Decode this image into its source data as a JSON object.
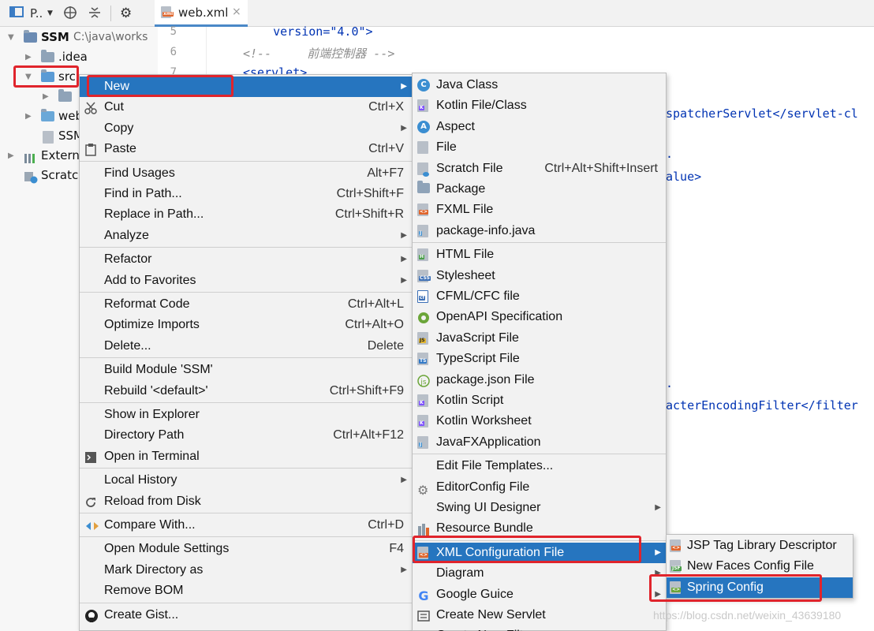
{
  "toolbar": {
    "project_label": "P..",
    "tab_label": "web.xml",
    "tab_close": "×"
  },
  "project_tree": {
    "root_name": "SSM",
    "root_path": "C:\\java\\works",
    "items": [
      ".idea",
      "src",
      "",
      "web",
      "SSM",
      "Externa",
      "Scratch"
    ]
  },
  "editor": {
    "line_numbers": [
      "5",
      "6",
      "7"
    ],
    "lines": [
      "    version=\"4.0\">",
      "<!--     前端控制器 -->",
      "<servlet>",
      "spatcherServlet</servlet-cl",
      ".",
      "alue>",
      ".",
      "acterEncodingFilter</filter"
    ]
  },
  "context_menu": [
    {
      "label": "New",
      "shortcut": "",
      "submenu": true,
      "selected": true,
      "icon": ""
    },
    {
      "label": "Cut",
      "shortcut": "Ctrl+X",
      "submenu": false,
      "icon": "scissors-icon"
    },
    {
      "label": "Copy",
      "shortcut": "",
      "submenu": true,
      "icon": ""
    },
    {
      "label": "Paste",
      "shortcut": "Ctrl+V",
      "submenu": false,
      "icon": "clipboard-icon"
    },
    {
      "label": "Find Usages",
      "shortcut": "Alt+F7",
      "submenu": false,
      "icon": ""
    },
    {
      "label": "Find in Path...",
      "shortcut": "Ctrl+Shift+F",
      "submenu": false,
      "icon": ""
    },
    {
      "label": "Replace in Path...",
      "shortcut": "Ctrl+Shift+R",
      "submenu": false,
      "icon": ""
    },
    {
      "label": "Analyze",
      "shortcut": "",
      "submenu": true,
      "icon": ""
    },
    {
      "label": "Refactor",
      "shortcut": "",
      "submenu": true,
      "icon": ""
    },
    {
      "label": "Add to Favorites",
      "shortcut": "",
      "submenu": true,
      "icon": ""
    },
    {
      "label": "Reformat Code",
      "shortcut": "Ctrl+Alt+L",
      "submenu": false,
      "icon": ""
    },
    {
      "label": "Optimize Imports",
      "shortcut": "Ctrl+Alt+O",
      "submenu": false,
      "icon": ""
    },
    {
      "label": "Delete...",
      "shortcut": "Delete",
      "submenu": false,
      "icon": ""
    },
    {
      "label": "Build Module 'SSM'",
      "shortcut": "",
      "submenu": false,
      "icon": ""
    },
    {
      "label": "Rebuild '<default>'",
      "shortcut": "Ctrl+Shift+F9",
      "submenu": false,
      "icon": ""
    },
    {
      "label": "Show in Explorer",
      "shortcut": "",
      "submenu": false,
      "icon": ""
    },
    {
      "label": "Directory Path",
      "shortcut": "Ctrl+Alt+F12",
      "submenu": false,
      "icon": ""
    },
    {
      "label": "Open in Terminal",
      "shortcut": "",
      "submenu": false,
      "icon": "terminal-icon"
    },
    {
      "label": "Local History",
      "shortcut": "",
      "submenu": true,
      "icon": ""
    },
    {
      "label": "Reload from Disk",
      "shortcut": "",
      "submenu": false,
      "icon": "reload-icon"
    },
    {
      "label": "Compare With...",
      "shortcut": "Ctrl+D",
      "submenu": false,
      "icon": "compare-icon"
    },
    {
      "label": "Open Module Settings",
      "shortcut": "F4",
      "submenu": false,
      "icon": ""
    },
    {
      "label": "Mark Directory as",
      "shortcut": "",
      "submenu": true,
      "icon": ""
    },
    {
      "label": "Remove BOM",
      "shortcut": "",
      "submenu": false,
      "icon": ""
    },
    {
      "label": "Create Gist...",
      "shortcut": "",
      "submenu": false,
      "icon": "github-icon"
    }
  ],
  "new_submenu": [
    {
      "label": "Java Class",
      "shortcut": "",
      "submenu": false,
      "icon": "java-class-icon"
    },
    {
      "label": "Kotlin File/Class",
      "shortcut": "",
      "submenu": false,
      "icon": "kotlin-icon"
    },
    {
      "label": "Aspect",
      "shortcut": "",
      "submenu": false,
      "icon": "aspect-icon"
    },
    {
      "label": "File",
      "shortcut": "",
      "submenu": false,
      "icon": "file-icon"
    },
    {
      "label": "Scratch File",
      "shortcut": "Ctrl+Alt+Shift+Insert",
      "submenu": false,
      "icon": "scratch-file-icon"
    },
    {
      "label": "Package",
      "shortcut": "",
      "submenu": false,
      "icon": "package-icon"
    },
    {
      "label": "FXML File",
      "shortcut": "",
      "submenu": false,
      "icon": "fxml-file-icon"
    },
    {
      "label": "package-info.java",
      "shortcut": "",
      "submenu": false,
      "icon": "package-info-icon"
    },
    {
      "label": "HTML File",
      "shortcut": "",
      "submenu": false,
      "icon": "html-file-icon"
    },
    {
      "label": "Stylesheet",
      "shortcut": "",
      "submenu": false,
      "icon": "css-file-icon"
    },
    {
      "label": "CFML/CFC file",
      "shortcut": "",
      "submenu": false,
      "icon": "cfml-file-icon"
    },
    {
      "label": "OpenAPI Specification",
      "shortcut": "",
      "submenu": false,
      "icon": "openapi-icon"
    },
    {
      "label": "JavaScript File",
      "shortcut": "",
      "submenu": false,
      "icon": "javascript-file-icon"
    },
    {
      "label": "TypeScript File",
      "shortcut": "",
      "submenu": false,
      "icon": "typescript-file-icon"
    },
    {
      "label": "package.json File",
      "shortcut": "",
      "submenu": false,
      "icon": "package-json-icon"
    },
    {
      "label": "Kotlin Script",
      "shortcut": "",
      "submenu": false,
      "icon": "kotlin-script-icon"
    },
    {
      "label": "Kotlin Worksheet",
      "shortcut": "",
      "submenu": false,
      "icon": "kotlin-worksheet-icon"
    },
    {
      "label": "JavaFXApplication",
      "shortcut": "",
      "submenu": false,
      "icon": "javafx-icon"
    },
    {
      "label": "Edit File Templates...",
      "shortcut": "",
      "submenu": false,
      "icon": ""
    },
    {
      "label": "EditorConfig File",
      "shortcut": "",
      "submenu": false,
      "icon": "editorconfig-icon"
    },
    {
      "label": "Swing UI Designer",
      "shortcut": "",
      "submenu": true,
      "icon": ""
    },
    {
      "label": "Resource Bundle",
      "shortcut": "",
      "submenu": false,
      "icon": "resource-bundle-icon"
    },
    {
      "label": "XML Configuration File",
      "shortcut": "",
      "submenu": true,
      "selected": true,
      "icon": "xml-config-icon"
    },
    {
      "label": "Diagram",
      "shortcut": "",
      "submenu": true,
      "icon": ""
    },
    {
      "label": "Google Guice",
      "shortcut": "",
      "submenu": true,
      "icon": "google-icon"
    },
    {
      "label": "Create New Servlet",
      "shortcut": "",
      "submenu": false,
      "icon": "servlet-icon"
    },
    {
      "label": "Create New Filter",
      "shortcut": "",
      "submenu": false,
      "icon": "filter-icon"
    }
  ],
  "xml_submenu": [
    {
      "label": "JSP Tag Library Descriptor",
      "shortcut": "",
      "submenu": false,
      "icon": "jsp-tag-icon"
    },
    {
      "label": "New Faces Config File",
      "shortcut": "",
      "submenu": false,
      "icon": "jsf-config-icon"
    },
    {
      "label": "Spring Config",
      "shortcut": "",
      "submenu": false,
      "selected": true,
      "icon": "spring-config-icon"
    }
  ],
  "watermark": "https://blog.csdn.net/weixin_43639180",
  "colors": {
    "selection": "#2675bf",
    "highlight_box": "#e0242c",
    "menu_bg": "#f2f2f2"
  }
}
